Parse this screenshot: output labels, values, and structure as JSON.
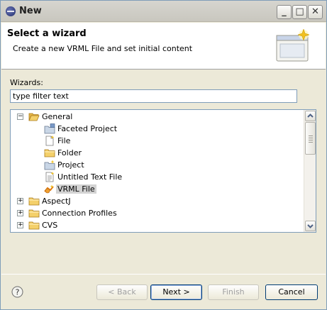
{
  "window": {
    "title": "New",
    "minimize_glyph": "_",
    "maximize_glyph": "□",
    "close_glyph": "✕"
  },
  "header": {
    "title": "Select a wizard",
    "description": "Create a new VRML File and set initial content",
    "banner_icon": "wizard-banner-icon"
  },
  "wizards": {
    "label": "Wizards:",
    "filter_value": "type filter text"
  },
  "tree": {
    "items": [
      {
        "label": "General",
        "icon": "folder-open-icon",
        "expander": "−",
        "level": 0,
        "selected": false
      },
      {
        "label": "Faceted Project",
        "icon": "faceted-project-icon",
        "expander": "",
        "level": 1,
        "selected": false
      },
      {
        "label": "File",
        "icon": "file-icon",
        "expander": "",
        "level": 1,
        "selected": false
      },
      {
        "label": "Folder",
        "icon": "folder-icon",
        "expander": "",
        "level": 1,
        "selected": false
      },
      {
        "label": "Project",
        "icon": "project-icon",
        "expander": "",
        "level": 1,
        "selected": false
      },
      {
        "label": "Untitled Text File",
        "icon": "text-file-icon",
        "expander": "",
        "level": 1,
        "selected": false
      },
      {
        "label": "VRML File",
        "icon": "vrml-file-icon",
        "expander": "",
        "level": 1,
        "selected": true
      },
      {
        "label": "AspectJ",
        "icon": "folder-icon",
        "expander": "+",
        "level": 0,
        "selected": false
      },
      {
        "label": "Connection Profiles",
        "icon": "folder-icon",
        "expander": "+",
        "level": 0,
        "selected": false
      },
      {
        "label": "CVS",
        "icon": "folder-icon",
        "expander": "+",
        "level": 0,
        "selected": false
      }
    ]
  },
  "buttons": {
    "back": "< Back",
    "next": "Next >",
    "finish": "Finish",
    "cancel": "Cancel",
    "help_glyph": "?"
  },
  "colors": {
    "selection": "#d3d3d3",
    "folder": "#f4d06a",
    "dialog_bg": "#ece9d8"
  }
}
